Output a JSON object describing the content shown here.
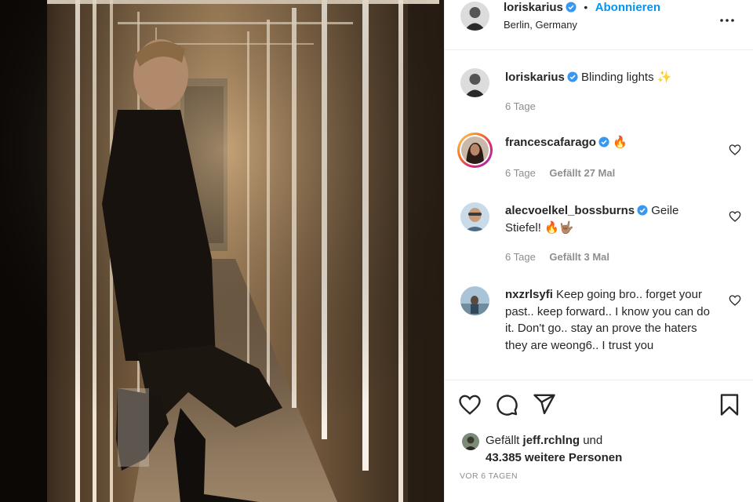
{
  "post": {
    "author": "loriskarius",
    "follow_label": "Abonnieren",
    "separator": "•",
    "location": "Berlin, Germany",
    "caption": {
      "user": "loriskarius",
      "text": "Blinding lights",
      "emoji": "✨",
      "time": "6 Tage"
    }
  },
  "comments": [
    {
      "user": "francescafarago",
      "text": "🔥",
      "time": "6 Tage",
      "likes": "Gefällt 27 Mal"
    },
    {
      "user": "alecvoelkel_bossburns",
      "text": "Geile Stiefel! 🔥🤟🏽",
      "time": "6 Tage",
      "likes": "Gefällt 3 Mal"
    },
    {
      "user": "nxzrlsyfi",
      "text": "Keep going bro.. forget your past.. keep forward.. I know you can do it. Don't go.. stay an prove the haters they are weong6.. I trust you"
    }
  ],
  "likes": {
    "prefix": "Gefällt",
    "first_user": "jeff.rchlng",
    "suffix": "und",
    "count_text": "43.385 weitere Personen"
  },
  "timestamp": "VOR 6 TAGEN",
  "colors": {
    "accent": "#0095f6",
    "muted": "#8e8e8e",
    "text": "#262626",
    "border": "#efefef"
  },
  "icons": [
    "more-icon",
    "heart-icon",
    "comment-icon",
    "share-icon",
    "bookmark-icon",
    "verified-badge-icon"
  ]
}
